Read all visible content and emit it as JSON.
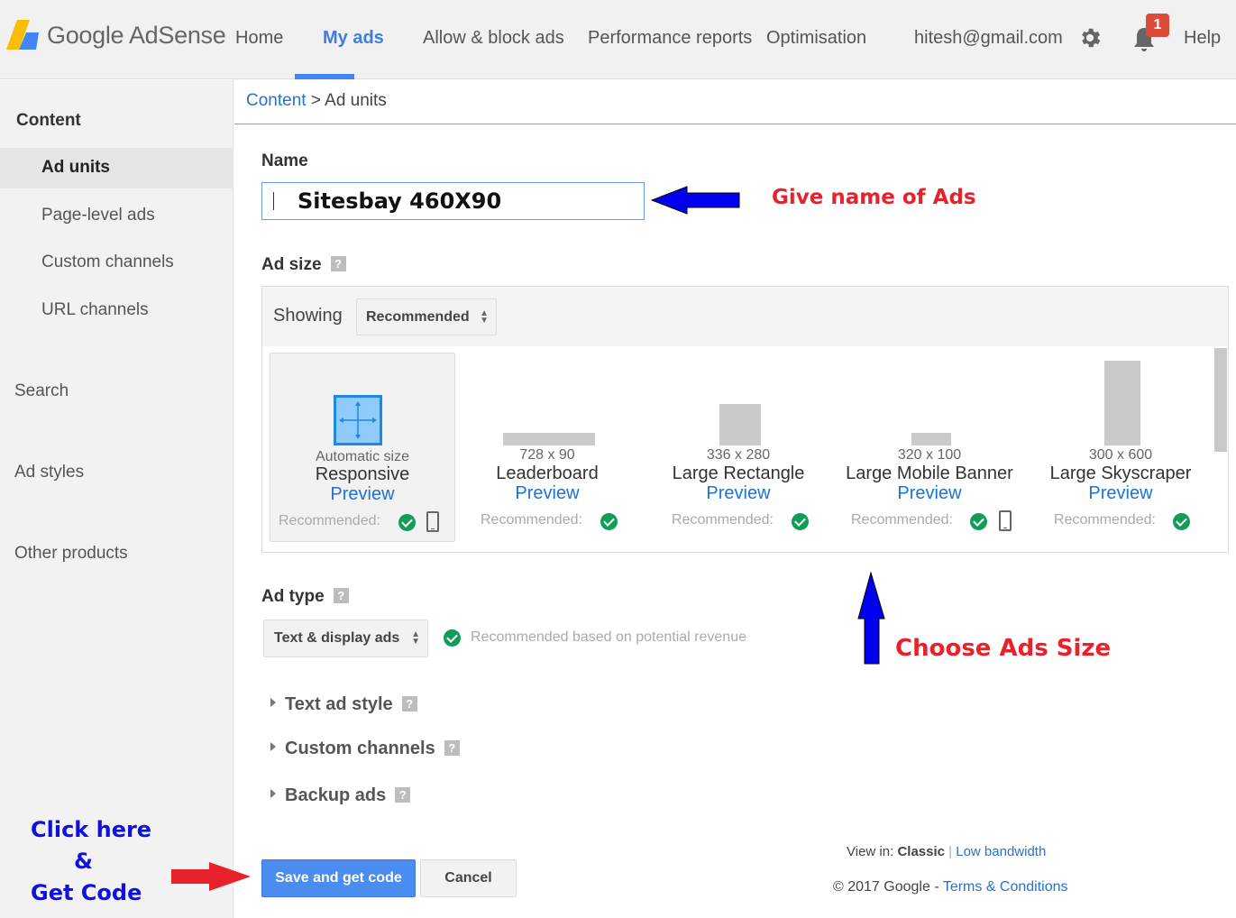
{
  "header": {
    "brand": "Google AdSense",
    "nav": [
      {
        "label": "Home",
        "active": false
      },
      {
        "label": "My ads",
        "active": true
      },
      {
        "label": "Allow & block ads",
        "active": false
      },
      {
        "label": "Performance reports",
        "active": false
      },
      {
        "label": "Optimisation",
        "active": false
      }
    ],
    "user_email": "hitesh@gmail.com",
    "notification_count": "1",
    "help_label": "Help",
    "icons": {
      "settings": "gear-icon",
      "notifications": "bell-icon"
    }
  },
  "sidebar": {
    "section_title": "Content",
    "content_items": [
      {
        "label": "Ad units",
        "selected": true
      },
      {
        "label": "Page-level ads",
        "selected": false
      },
      {
        "label": "Custom channels",
        "selected": false
      },
      {
        "label": "URL channels",
        "selected": false
      }
    ],
    "top_items": [
      {
        "label": "Search"
      },
      {
        "label": "Ad styles"
      },
      {
        "label": "Other products"
      }
    ]
  },
  "breadcrumb": {
    "parent": "Content",
    "separator": " > ",
    "current": "Ad units"
  },
  "form": {
    "name_label": "Name",
    "name_value": "Sitesbay 460X90",
    "ad_size_label": "Ad size",
    "showing_label": "Showing",
    "showing_value": "Recommended",
    "ad_sizes": [
      {
        "dims": "Automatic size",
        "title": "Responsive",
        "preview": "Preview",
        "recommended": "Recommended:",
        "mobile": true,
        "selected": true
      },
      {
        "dims": "728 x 90",
        "title": "Leaderboard",
        "preview": "Preview",
        "recommended": "Recommended:",
        "mobile": false,
        "selected": false
      },
      {
        "dims": "336 x 280",
        "title": "Large Rectangle",
        "preview": "Preview",
        "recommended": "Recommended:",
        "mobile": false,
        "selected": false
      },
      {
        "dims": "320 x 100",
        "title": "Large Mobile Banner",
        "preview": "Preview",
        "recommended": "Recommended:",
        "mobile": true,
        "selected": false
      },
      {
        "dims": "300 x 600",
        "title": "Large Skyscraper",
        "preview": "Preview",
        "recommended": "Recommended:",
        "mobile": false,
        "selected": false
      }
    ],
    "ad_type_label": "Ad type",
    "ad_type_value": "Text & display ads",
    "ad_type_note": "Recommended based on potential revenue",
    "sections": [
      {
        "label": "Text ad style"
      },
      {
        "label": "Custom channels"
      },
      {
        "label": "Backup ads"
      }
    ],
    "save_label": "Save and get code",
    "cancel_label": "Cancel"
  },
  "footer": {
    "view_in_label": "View in:",
    "view_classic": "Classic",
    "view_sep": "|",
    "view_low_bandwidth": "Low bandwidth",
    "copyright": "© 2017 Google",
    "copy_sep": "-",
    "terms": "Terms & Conditions"
  },
  "annotations": {
    "name_hint": "Give name of Ads",
    "size_hint": "Choose Ads Size",
    "click_line1": "Click here",
    "click_line2": "&",
    "click_line3": "Get Code"
  },
  "colors": {
    "accent": "#4285f4",
    "link": "#2673cc",
    "check": "#0f9d58",
    "annotation_red": "#e8222a",
    "annotation_blue": "#1010e0",
    "badge": "#dd4b39"
  }
}
